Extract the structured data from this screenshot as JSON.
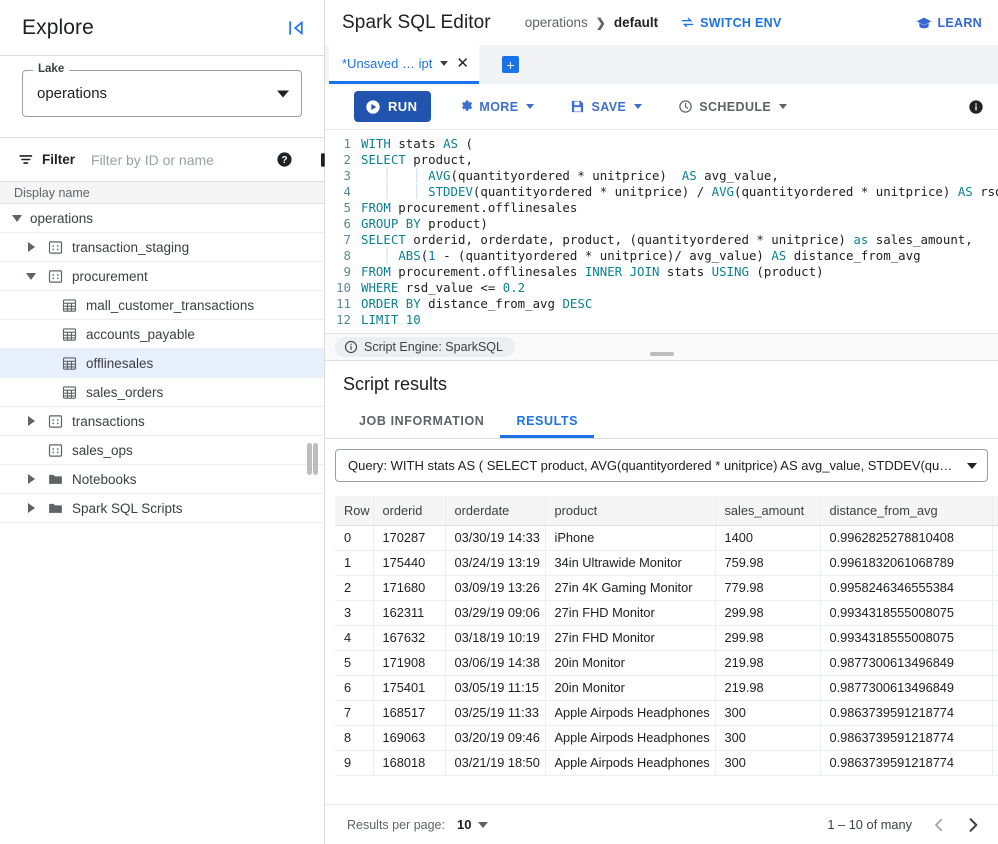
{
  "sidebar": {
    "title": "Explore",
    "collapse_icon": "collapse-panel-icon",
    "lake": {
      "legend": "Lake",
      "value": "operations"
    },
    "filter": {
      "label": "Filter",
      "placeholder": "Filter by ID or name",
      "value": ""
    },
    "tree_header": "Display name",
    "tree": [
      {
        "label": "operations",
        "indent": 0,
        "caret": "down",
        "icon": "none"
      },
      {
        "label": "transaction_staging",
        "indent": 1,
        "caret": "right",
        "icon": "dataset"
      },
      {
        "label": "procurement",
        "indent": 1,
        "caret": "down",
        "icon": "dataset"
      },
      {
        "label": "mall_customer_transactions",
        "indent": 2,
        "caret": "none",
        "icon": "table"
      },
      {
        "label": "accounts_payable",
        "indent": 2,
        "caret": "none",
        "icon": "table"
      },
      {
        "label": "offlinesales",
        "indent": 2,
        "caret": "none",
        "icon": "table",
        "selected": true
      },
      {
        "label": "sales_orders",
        "indent": 2,
        "caret": "none",
        "icon": "table"
      },
      {
        "label": "transactions",
        "indent": 1,
        "caret": "right",
        "icon": "dataset"
      },
      {
        "label": "sales_ops",
        "indent": 1,
        "caret": "none",
        "icon": "dataset"
      },
      {
        "label": "Notebooks",
        "indent": 1,
        "caret": "right",
        "icon": "folder"
      },
      {
        "label": "Spark SQL Scripts",
        "indent": 1,
        "caret": "right",
        "icon": "folder"
      }
    ]
  },
  "header": {
    "title": "Spark SQL Editor",
    "breadcrumb_root": "operations",
    "breadcrumb_sep": "❯",
    "breadcrumb_current": "default",
    "switch_env": "SWITCH ENV",
    "learn": "LEARN"
  },
  "tabstrip": {
    "file_tab": "*Unsaved … ipt",
    "close_glyph": "✕",
    "add_glyph": "+"
  },
  "toolbar": {
    "run": "RUN",
    "more": "MORE",
    "save": "SAVE",
    "schedule": "SCHEDULE",
    "info_icon": "info-icon"
  },
  "editor": {
    "lines": [
      {
        "n": "1",
        "tokens": [
          {
            "t": "WITH ",
            "c": "kw"
          },
          {
            "t": "stats ",
            "c": "p"
          },
          {
            "t": "AS",
            "c": "kw"
          },
          {
            "t": " (",
            "c": "p"
          }
        ]
      },
      {
        "n": "2",
        "tokens": [
          {
            "t": "SELECT",
            "c": "kw"
          },
          {
            "t": " product,",
            "c": "p"
          }
        ]
      },
      {
        "n": "3",
        "tokens": [
          {
            "t": "   │   │ ",
            "c": "g"
          },
          {
            "t": "AVG",
            "c": "kw"
          },
          {
            "t": "(quantityordered * unitprice)  ",
            "c": "p"
          },
          {
            "t": "AS",
            "c": "kw"
          },
          {
            "t": " avg_value,",
            "c": "p"
          }
        ]
      },
      {
        "n": "4",
        "tokens": [
          {
            "t": "   │   │ ",
            "c": "g"
          },
          {
            "t": "STDDEV",
            "c": "kw"
          },
          {
            "t": "(quantityordered * unitprice) / ",
            "c": "p"
          },
          {
            "t": "AVG",
            "c": "kw"
          },
          {
            "t": "(quantityordered * unitprice) ",
            "c": "p"
          },
          {
            "t": "AS",
            "c": "kw"
          },
          {
            "t": " rsd_v",
            "c": "p"
          }
        ]
      },
      {
        "n": "5",
        "tokens": [
          {
            "t": "FROM",
            "c": "kw"
          },
          {
            "t": " procurement.offlinesales",
            "c": "p"
          }
        ]
      },
      {
        "n": "6",
        "tokens": [
          {
            "t": "GROUP BY",
            "c": "kw"
          },
          {
            "t": " product)",
            "c": "p"
          }
        ]
      },
      {
        "n": "7",
        "tokens": [
          {
            "t": "SELECT",
            "c": "kw"
          },
          {
            "t": " orderid, orderdate, product, (quantityordered * unitprice) ",
            "c": "p"
          },
          {
            "t": "as",
            "c": "kw"
          },
          {
            "t": " sales_amount,",
            "c": "p"
          }
        ]
      },
      {
        "n": "8",
        "tokens": [
          {
            "t": "   │ ",
            "c": "g"
          },
          {
            "t": "ABS",
            "c": "kw"
          },
          {
            "t": "(",
            "c": "p"
          },
          {
            "t": "1",
            "c": "num"
          },
          {
            "t": " - (quantityordered * unitprice)/ avg_value) ",
            "c": "p"
          },
          {
            "t": "AS",
            "c": "kw"
          },
          {
            "t": " distance_from_avg",
            "c": "p"
          }
        ]
      },
      {
        "n": "9",
        "tokens": [
          {
            "t": "FROM",
            "c": "kw"
          },
          {
            "t": " procurement.offlinesales ",
            "c": "p"
          },
          {
            "t": "INNER JOIN",
            "c": "kw"
          },
          {
            "t": " stats ",
            "c": "p"
          },
          {
            "t": "USING",
            "c": "kw"
          },
          {
            "t": " (product)",
            "c": "p"
          }
        ]
      },
      {
        "n": "10",
        "tokens": [
          {
            "t": "WHERE",
            "c": "kw"
          },
          {
            "t": " rsd_value <= ",
            "c": "p"
          },
          {
            "t": "0.2",
            "c": "num"
          }
        ]
      },
      {
        "n": "11",
        "tokens": [
          {
            "t": "ORDER BY",
            "c": "kw"
          },
          {
            "t": " distance_from_avg ",
            "c": "p"
          },
          {
            "t": "DESC",
            "c": "kw"
          }
        ]
      },
      {
        "n": "12",
        "tokens": [
          {
            "t": "LIMIT",
            "c": "kw"
          },
          {
            "t": " ",
            "c": "p"
          },
          {
            "t": "10",
            "c": "num"
          }
        ]
      }
    ]
  },
  "engine_bar": {
    "chip": "Script Engine: SparkSQL"
  },
  "results": {
    "title": "Script results",
    "tabs": [
      {
        "label": "JOB INFORMATION",
        "active": false
      },
      {
        "label": "RESULTS",
        "active": true
      }
    ],
    "query_select": "Query: WITH stats AS ( SELECT product, AVG(quantityordered * unitprice) AS avg_value, STDDEV(quantityorder…",
    "columns": [
      "Row",
      "orderid",
      "orderdate",
      "product",
      "sales_amount",
      "distance_from_avg",
      ""
    ],
    "rows": [
      [
        "0",
        "170287",
        "03/30/19 14:33",
        "iPhone",
        "1400",
        "0.9962825278810408",
        ""
      ],
      [
        "1",
        "175440",
        "03/24/19 13:19",
        "34in Ultrawide Monitor",
        "759.98",
        "0.9961832061068789",
        ""
      ],
      [
        "2",
        "171680",
        "03/09/19 13:26",
        "27in 4K Gaming Monitor",
        "779.98",
        "0.9958246346555384",
        ""
      ],
      [
        "3",
        "162311",
        "03/29/19 09:06",
        "27in FHD Monitor",
        "299.98",
        "0.9934318555008075",
        ""
      ],
      [
        "4",
        "167632",
        "03/18/19 10:19",
        "27in FHD Monitor",
        "299.98",
        "0.9934318555008075",
        ""
      ],
      [
        "5",
        "171908",
        "03/06/19 14:38",
        "20in Monitor",
        "219.98",
        "0.9877300613496849",
        ""
      ],
      [
        "6",
        "175401",
        "03/05/19 11:15",
        "20in Monitor",
        "219.98",
        "0.9877300613496849",
        ""
      ],
      [
        "7",
        "168517",
        "03/25/19 11:33",
        "Apple Airpods Headphones",
        "300",
        "0.9863739591218774",
        ""
      ],
      [
        "8",
        "169063",
        "03/20/19 09:46",
        "Apple Airpods Headphones",
        "300",
        "0.9863739591218774",
        ""
      ],
      [
        "9",
        "168018",
        "03/21/19 18:50",
        "Apple Airpods Headphones",
        "300",
        "0.9863739591218774",
        ""
      ]
    ]
  },
  "pager": {
    "per_page_label": "Results per page:",
    "per_page_value": "10",
    "range": "1 – 10 of many",
    "prev_glyph": "‹",
    "next_glyph": "›"
  },
  "colors": {
    "accent_blue": "#1a73e8",
    "run_blue": "#2054ae",
    "selected_row": "#e8f0fe",
    "keyword_teal": "#0b8294",
    "header_grey": "#f5f5f5"
  }
}
